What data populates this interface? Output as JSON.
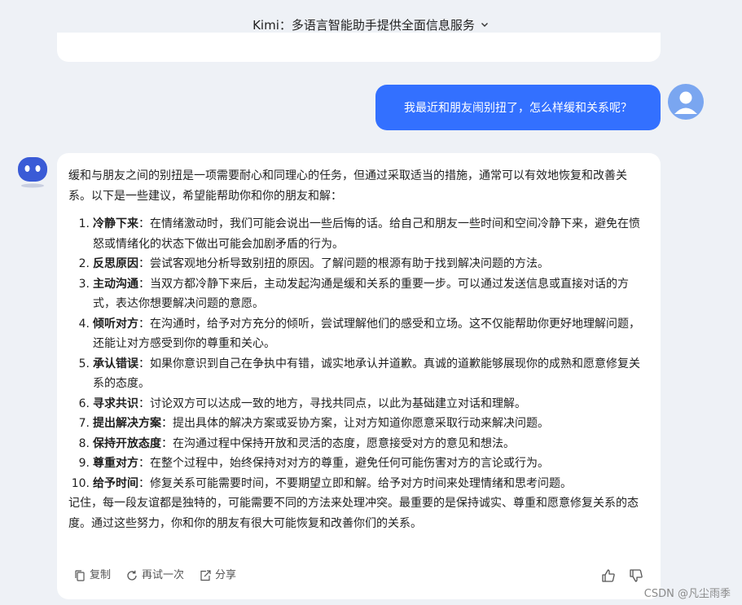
{
  "header": {
    "title": "Kimi：多语言智能助手提供全面信息服务"
  },
  "user_message": "我最近和朋友闹别扭了，怎么样缓和关系呢？",
  "answer": {
    "intro": "缓和与朋友之间的别扭是一项需要耐心和同理心的任务，但通过采取适当的措施，通常可以有效地恢复和改善关系。以下是一些建议，希望能帮助你和你的朋友和解：",
    "tips": [
      {
        "num": "1.",
        "title": "冷静下来",
        "text": "：在情绪激动时，我们可能会说出一些后悔的话。给自己和朋友一些时间和空间冷静下来，避免在愤怒或情绪化的状态下做出可能会加剧矛盾的行为。"
      },
      {
        "num": "2.",
        "title": "反思原因",
        "text": "：尝试客观地分析导致别扭的原因。了解问题的根源有助于找到解决问题的方法。"
      },
      {
        "num": "3.",
        "title": "主动沟通",
        "text": "：当双方都冷静下来后，主动发起沟通是缓和关系的重要一步。可以通过发送信息或直接对话的方式，表达你想要解决问题的意愿。"
      },
      {
        "num": "4.",
        "title": "倾听对方",
        "text": "：在沟通时，给予对方充分的倾听，尝试理解他们的感受和立场。这不仅能帮助你更好地理解问题，还能让对方感受到你的尊重和关心。"
      },
      {
        "num": "5.",
        "title": "承认错误",
        "text": "：如果你意识到自己在争执中有错，诚实地承认并道歉。真诚的道歉能够展现你的成熟和愿意修复关系的态度。"
      },
      {
        "num": "6.",
        "title": "寻求共识",
        "text": "：讨论双方可以达成一致的地方，寻找共同点，以此为基础建立对话和理解。"
      },
      {
        "num": "7.",
        "title": "提出解决方案",
        "text": "：提出具体的解决方案或妥协方案，让对方知道你愿意采取行动来解决问题。"
      },
      {
        "num": "8.",
        "title": "保持开放态度",
        "text": "：在沟通过程中保持开放和灵活的态度，愿意接受对方的意见和想法。"
      },
      {
        "num": "9.",
        "title": "尊重对方",
        "text": "：在整个过程中，始终保持对对方的尊重，避免任何可能伤害对方的言论或行为。"
      },
      {
        "num": "10.",
        "title": "给予时间",
        "text": "：修复关系可能需要时间，不要期望立即和解。给予对方时间来处理情绪和思考问题。"
      }
    ],
    "outro": "记住，每一段友谊都是独特的，可能需要不同的方法来处理冲突。最重要的是保持诚实、尊重和愿意修复关系的态度。通过这些努力，你和你的朋友有很大可能恢复和改善你们的关系。"
  },
  "actions": {
    "copy": "复制",
    "retry": "再试一次",
    "share": "分享"
  },
  "watermark": "CSDN @凡尘雨季",
  "icons": [
    "chevron-down-icon",
    "user-avatar-icon",
    "kimi-bot-icon",
    "copy-icon",
    "retry-icon",
    "share-icon",
    "thumbs-up-icon",
    "thumbs-down-icon"
  ],
  "colors": {
    "background": "#eef1f6",
    "user_bubble": "#3370ff",
    "card": "#ffffff",
    "user_avatar": "#7aa6f0",
    "bot_avatar": "#3a5bd6"
  }
}
